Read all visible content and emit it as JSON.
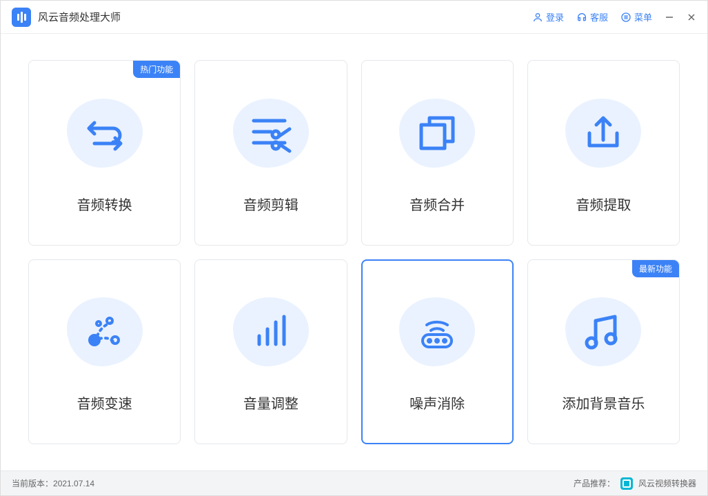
{
  "app": {
    "title": "风云音频处理大师"
  },
  "titlebar": {
    "login": "登录",
    "support": "客服",
    "menu": "菜单"
  },
  "badges": {
    "hot": "热门功能",
    "new": "最新功能"
  },
  "cards": [
    {
      "label": "音频转换"
    },
    {
      "label": "音频剪辑"
    },
    {
      "label": "音频合并"
    },
    {
      "label": "音频提取"
    },
    {
      "label": "音频变速"
    },
    {
      "label": "音量调整"
    },
    {
      "label": "噪声消除"
    },
    {
      "label": "添加背景音乐"
    }
  ],
  "footer": {
    "version_label": "当前版本：",
    "version": "2021.07.14",
    "recommend_label": "产品推荐：",
    "recommend_product": "风云视频转换器"
  }
}
